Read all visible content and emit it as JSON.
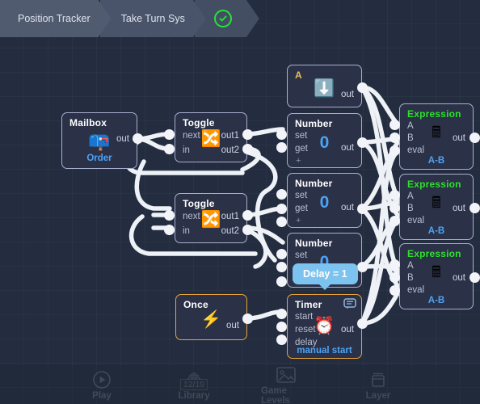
{
  "breadcrumb": {
    "items": [
      {
        "label": "Position Tracker",
        "icon": null
      },
      {
        "label": "Take Turn Sys",
        "icon": null
      },
      {
        "label": "",
        "icon": "circle-check-icon"
      }
    ],
    "check_color": "#24e33a"
  },
  "tooltip": {
    "text": "Delay = 1",
    "color": "#7cc3f0"
  },
  "nodes": [
    {
      "id": "mailbox",
      "title": "Mailbox",
      "icon": "mailbox-icon",
      "sub_label": "Order",
      "outputs": [
        "out"
      ],
      "inputs": [],
      "border": "#a9afd0"
    },
    {
      "id": "toggle1",
      "title": "Toggle",
      "icon": "shuffle-icon",
      "inputs": [
        "next",
        "in"
      ],
      "outputs": [
        "out1",
        "out2"
      ],
      "border": "#a9afd0"
    },
    {
      "id": "toggle2",
      "title": "Toggle",
      "icon": "shuffle-icon",
      "inputs": [
        "next",
        "in"
      ],
      "outputs": [
        "out1",
        "out2"
      ],
      "border": "#a9afd0"
    },
    {
      "id": "a-node",
      "title": "A",
      "title_color": "#e8c05a",
      "icon": "down-arrow-icon",
      "inputs": [],
      "outputs": [
        "out"
      ],
      "border": "#a9afd0"
    },
    {
      "id": "number1",
      "title": "Number",
      "value": "0",
      "inputs": [
        "set",
        "get",
        "+"
      ],
      "outputs": [
        "out"
      ],
      "border": "#a9afd0"
    },
    {
      "id": "number2",
      "title": "Number",
      "value": "0",
      "inputs": [
        "set",
        "get",
        "+"
      ],
      "outputs": [
        "out"
      ],
      "border": "#a9afd0"
    },
    {
      "id": "number3",
      "title": "Number",
      "value": "0",
      "inputs": [
        "set",
        "get",
        "+"
      ],
      "outputs": [
        "out"
      ],
      "border": "#a9afd0"
    },
    {
      "id": "expression1",
      "title": "Expression",
      "title_color": "#2ee02e",
      "icon": "calculator-icon",
      "sub_label": "A-B",
      "inputs": [
        "A",
        "B",
        "eval"
      ],
      "outputs": [
        "out"
      ],
      "border": "#a9afd0"
    },
    {
      "id": "expression2",
      "title": "Expression",
      "title_color": "#2ee02e",
      "icon": "calculator-icon",
      "sub_label": "A-B",
      "inputs": [
        "A",
        "B",
        "eval"
      ],
      "outputs": [
        "out"
      ],
      "border": "#a9afd0"
    },
    {
      "id": "expression3",
      "title": "Expression",
      "title_color": "#2ee02e",
      "icon": "calculator-icon",
      "sub_label": "A-B",
      "inputs": [
        "A",
        "B",
        "eval"
      ],
      "outputs": [
        "out"
      ],
      "border": "#a9afd0"
    },
    {
      "id": "once",
      "title": "Once",
      "icon": "lightning-icon",
      "inputs": [],
      "outputs": [
        "out"
      ],
      "border": "#e8a33a"
    },
    {
      "id": "timer",
      "title": "Timer",
      "icon": "alarm-clock-icon",
      "sub_label": "manual start",
      "inputs": [
        "start",
        "reset",
        "delay"
      ],
      "outputs": [
        "out"
      ],
      "border": "#e8a33a",
      "comment_icon": "comment-icon"
    }
  ],
  "node_text": {
    "mailbox_title": "Mailbox",
    "mailbox_out": "out",
    "mailbox_sub": "Order",
    "toggle_title": "Toggle",
    "toggle_in_next": "next",
    "toggle_in_in": "in",
    "toggle_out1": "out1",
    "toggle_out2": "out2",
    "a_title": "A",
    "a_out": "out",
    "number_title": "Number",
    "number_set": "set",
    "number_get": "get",
    "number_plus": "+",
    "number_out": "out",
    "number_value": "0",
    "expression_title": "Expression",
    "expression_a": "A",
    "expression_b": "B",
    "expression_eval": "eval",
    "expression_out": "out",
    "expression_sub": "A-B",
    "once_title": "Once",
    "once_out": "out",
    "timer_title": "Timer",
    "timer_start": "start",
    "timer_reset": "reset",
    "timer_delay": "delay",
    "timer_out": "out",
    "timer_sub": "manual start"
  },
  "bottombar": {
    "items": [
      {
        "label": "Play",
        "icon": "play-circle-icon",
        "badge": null
      },
      {
        "label": "Library",
        "icon": "library-icon",
        "badge": "12/19"
      },
      {
        "label": "Game Levels",
        "icon": "image-icon",
        "badge": null
      },
      {
        "label": "Layer",
        "icon": "layer-icon",
        "badge": null
      }
    ]
  },
  "colors": {
    "canvas_bg": "#232d3f",
    "node_bg": "#2b3147",
    "node_border": "#a9afd0",
    "accent_orange": "#e8a33a",
    "accent_blue": "#4da3f5",
    "accent_green": "#2ee02e",
    "wire": "#eef1f6"
  }
}
